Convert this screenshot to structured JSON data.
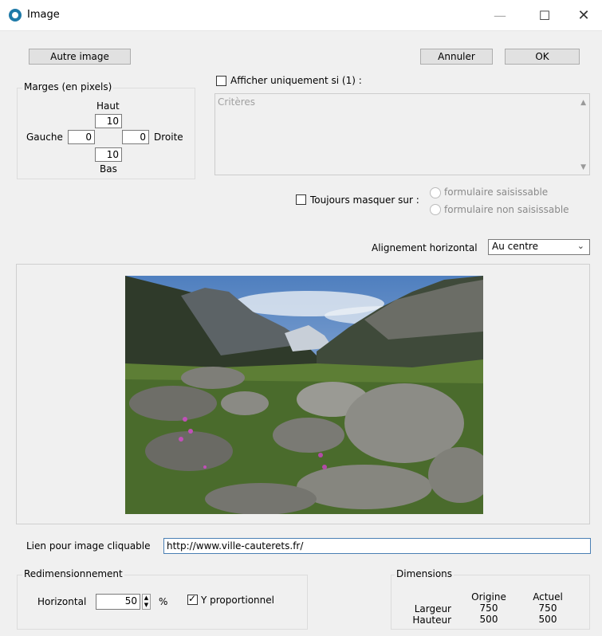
{
  "window": {
    "title": "Image"
  },
  "buttons": {
    "autre_image": "Autre image",
    "annuler": "Annuler",
    "ok": "OK"
  },
  "marges": {
    "legend": "Marges (en pixels)",
    "haut_label": "Haut",
    "haut_value": "10",
    "gauche_label": "Gauche",
    "gauche_value": "0",
    "droite_label": "Droite",
    "droite_value": "0",
    "bas_label": "Bas",
    "bas_value": "10"
  },
  "afficher": {
    "label": "Afficher uniquement si (1) :",
    "checked": false,
    "criteres_placeholder": "Critères"
  },
  "toujours_masquer": {
    "label": "Toujours masquer sur :",
    "checked": false,
    "option1": "formulaire saisissable",
    "option2": "formulaire non saisissable"
  },
  "alignement": {
    "label": "Alignement horizontal",
    "value": "Au centre"
  },
  "lien": {
    "label": "Lien pour image cliquable",
    "value": "http://www.ville-cauterets.fr/"
  },
  "redim": {
    "legend": "Redimensionnement",
    "horizontal_label": "Horizontal",
    "horizontal_value": "50",
    "unit": "%",
    "proportional_label": "Y proportionnel",
    "proportional_checked": true
  },
  "dimensions": {
    "legend": "Dimensions",
    "col_origine": "Origine",
    "col_actuel": "Actuel",
    "row_largeur": "Largeur",
    "row_hauteur": "Hauteur",
    "largeur_origine": "750",
    "largeur_actuel": "750",
    "hauteur_origine": "500",
    "hauteur_actuel": "500"
  },
  "colors": {
    "accent": "#1f7aa8",
    "sky": "#6b97cf",
    "grass": "#6b8e3a",
    "rock": "#8a8a86"
  }
}
